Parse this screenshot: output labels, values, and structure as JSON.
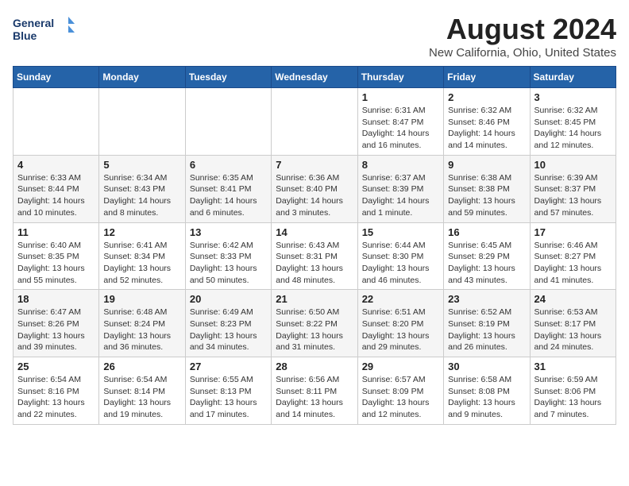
{
  "logo": {
    "line1": "General",
    "line2": "Blue"
  },
  "title": "August 2024",
  "subtitle": "New California, Ohio, United States",
  "days_header": [
    "Sunday",
    "Monday",
    "Tuesday",
    "Wednesday",
    "Thursday",
    "Friday",
    "Saturday"
  ],
  "weeks": [
    [
      {
        "day": "",
        "sunrise": "",
        "sunset": "",
        "daylight": ""
      },
      {
        "day": "",
        "sunrise": "",
        "sunset": "",
        "daylight": ""
      },
      {
        "day": "",
        "sunrise": "",
        "sunset": "",
        "daylight": ""
      },
      {
        "day": "",
        "sunrise": "",
        "sunset": "",
        "daylight": ""
      },
      {
        "day": "1",
        "sunrise": "Sunrise: 6:31 AM",
        "sunset": "Sunset: 8:47 PM",
        "daylight": "Daylight: 14 hours and 16 minutes."
      },
      {
        "day": "2",
        "sunrise": "Sunrise: 6:32 AM",
        "sunset": "Sunset: 8:46 PM",
        "daylight": "Daylight: 14 hours and 14 minutes."
      },
      {
        "day": "3",
        "sunrise": "Sunrise: 6:32 AM",
        "sunset": "Sunset: 8:45 PM",
        "daylight": "Daylight: 14 hours and 12 minutes."
      }
    ],
    [
      {
        "day": "4",
        "sunrise": "Sunrise: 6:33 AM",
        "sunset": "Sunset: 8:44 PM",
        "daylight": "Daylight: 14 hours and 10 minutes."
      },
      {
        "day": "5",
        "sunrise": "Sunrise: 6:34 AM",
        "sunset": "Sunset: 8:43 PM",
        "daylight": "Daylight: 14 hours and 8 minutes."
      },
      {
        "day": "6",
        "sunrise": "Sunrise: 6:35 AM",
        "sunset": "Sunset: 8:41 PM",
        "daylight": "Daylight: 14 hours and 6 minutes."
      },
      {
        "day": "7",
        "sunrise": "Sunrise: 6:36 AM",
        "sunset": "Sunset: 8:40 PM",
        "daylight": "Daylight: 14 hours and 3 minutes."
      },
      {
        "day": "8",
        "sunrise": "Sunrise: 6:37 AM",
        "sunset": "Sunset: 8:39 PM",
        "daylight": "Daylight: 14 hours and 1 minute."
      },
      {
        "day": "9",
        "sunrise": "Sunrise: 6:38 AM",
        "sunset": "Sunset: 8:38 PM",
        "daylight": "Daylight: 13 hours and 59 minutes."
      },
      {
        "day": "10",
        "sunrise": "Sunrise: 6:39 AM",
        "sunset": "Sunset: 8:37 PM",
        "daylight": "Daylight: 13 hours and 57 minutes."
      }
    ],
    [
      {
        "day": "11",
        "sunrise": "Sunrise: 6:40 AM",
        "sunset": "Sunset: 8:35 PM",
        "daylight": "Daylight: 13 hours and 55 minutes."
      },
      {
        "day": "12",
        "sunrise": "Sunrise: 6:41 AM",
        "sunset": "Sunset: 8:34 PM",
        "daylight": "Daylight: 13 hours and 52 minutes."
      },
      {
        "day": "13",
        "sunrise": "Sunrise: 6:42 AM",
        "sunset": "Sunset: 8:33 PM",
        "daylight": "Daylight: 13 hours and 50 minutes."
      },
      {
        "day": "14",
        "sunrise": "Sunrise: 6:43 AM",
        "sunset": "Sunset: 8:31 PM",
        "daylight": "Daylight: 13 hours and 48 minutes."
      },
      {
        "day": "15",
        "sunrise": "Sunrise: 6:44 AM",
        "sunset": "Sunset: 8:30 PM",
        "daylight": "Daylight: 13 hours and 46 minutes."
      },
      {
        "day": "16",
        "sunrise": "Sunrise: 6:45 AM",
        "sunset": "Sunset: 8:29 PM",
        "daylight": "Daylight: 13 hours and 43 minutes."
      },
      {
        "day": "17",
        "sunrise": "Sunrise: 6:46 AM",
        "sunset": "Sunset: 8:27 PM",
        "daylight": "Daylight: 13 hours and 41 minutes."
      }
    ],
    [
      {
        "day": "18",
        "sunrise": "Sunrise: 6:47 AM",
        "sunset": "Sunset: 8:26 PM",
        "daylight": "Daylight: 13 hours and 39 minutes."
      },
      {
        "day": "19",
        "sunrise": "Sunrise: 6:48 AM",
        "sunset": "Sunset: 8:24 PM",
        "daylight": "Daylight: 13 hours and 36 minutes."
      },
      {
        "day": "20",
        "sunrise": "Sunrise: 6:49 AM",
        "sunset": "Sunset: 8:23 PM",
        "daylight": "Daylight: 13 hours and 34 minutes."
      },
      {
        "day": "21",
        "sunrise": "Sunrise: 6:50 AM",
        "sunset": "Sunset: 8:22 PM",
        "daylight": "Daylight: 13 hours and 31 minutes."
      },
      {
        "day": "22",
        "sunrise": "Sunrise: 6:51 AM",
        "sunset": "Sunset: 8:20 PM",
        "daylight": "Daylight: 13 hours and 29 minutes."
      },
      {
        "day": "23",
        "sunrise": "Sunrise: 6:52 AM",
        "sunset": "Sunset: 8:19 PM",
        "daylight": "Daylight: 13 hours and 26 minutes."
      },
      {
        "day": "24",
        "sunrise": "Sunrise: 6:53 AM",
        "sunset": "Sunset: 8:17 PM",
        "daylight": "Daylight: 13 hours and 24 minutes."
      }
    ],
    [
      {
        "day": "25",
        "sunrise": "Sunrise: 6:54 AM",
        "sunset": "Sunset: 8:16 PM",
        "daylight": "Daylight: 13 hours and 22 minutes."
      },
      {
        "day": "26",
        "sunrise": "Sunrise: 6:54 AM",
        "sunset": "Sunset: 8:14 PM",
        "daylight": "Daylight: 13 hours and 19 minutes."
      },
      {
        "day": "27",
        "sunrise": "Sunrise: 6:55 AM",
        "sunset": "Sunset: 8:13 PM",
        "daylight": "Daylight: 13 hours and 17 minutes."
      },
      {
        "day": "28",
        "sunrise": "Sunrise: 6:56 AM",
        "sunset": "Sunset: 8:11 PM",
        "daylight": "Daylight: 13 hours and 14 minutes."
      },
      {
        "day": "29",
        "sunrise": "Sunrise: 6:57 AM",
        "sunset": "Sunset: 8:09 PM",
        "daylight": "Daylight: 13 hours and 12 minutes."
      },
      {
        "day": "30",
        "sunrise": "Sunrise: 6:58 AM",
        "sunset": "Sunset: 8:08 PM",
        "daylight": "Daylight: 13 hours and 9 minutes."
      },
      {
        "day": "31",
        "sunrise": "Sunrise: 6:59 AM",
        "sunset": "Sunset: 8:06 PM",
        "daylight": "Daylight: 13 hours and 7 minutes."
      }
    ]
  ]
}
